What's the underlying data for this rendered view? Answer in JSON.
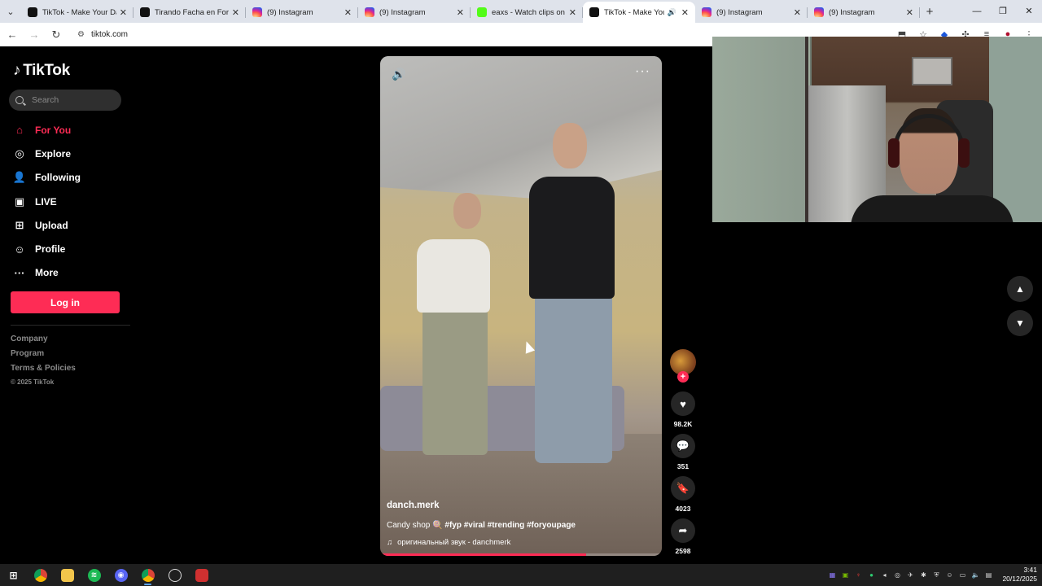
{
  "browser": {
    "tabs": [
      {
        "title": "TikTok - Make Your Day",
        "favicon": "tiktok-favicon",
        "active": false
      },
      {
        "title": "Tirando Facha en Fortnite",
        "favicon": "tiktok-favicon",
        "active": false
      },
      {
        "title": "(9) Instagram",
        "favicon": "instagram-favicon",
        "active": false
      },
      {
        "title": "(9) Instagram",
        "favicon": "instagram-favicon",
        "active": false
      },
      {
        "title": "eaxs - Watch clips on Kick",
        "favicon": "kick-favicon",
        "active": false
      },
      {
        "title": "TikTok - Make Your Day",
        "favicon": "tiktok-favicon",
        "active": true
      },
      {
        "title": "(9) Instagram",
        "favicon": "instagram-favicon",
        "active": false
      },
      {
        "title": "(9) Instagram",
        "favicon": "instagram-favicon",
        "active": false
      }
    ],
    "url": "tiktok.com"
  },
  "sidebar": {
    "logo_text": "TikTok",
    "search_placeholder": "Search",
    "nav_items": [
      {
        "label": "For You",
        "icon": "home-icon",
        "active": true
      },
      {
        "label": "Explore",
        "icon": "compass-icon",
        "active": false
      },
      {
        "label": "Following",
        "icon": "following-icon",
        "active": false
      },
      {
        "label": "LIVE",
        "icon": "live-icon",
        "active": false
      },
      {
        "label": "Upload",
        "icon": "upload-icon",
        "active": false
      },
      {
        "label": "Profile",
        "icon": "profile-icon",
        "active": false
      },
      {
        "label": "More",
        "icon": "more-icon",
        "active": false
      }
    ],
    "login_label": "Log in",
    "footer_links": [
      "Company",
      "Program",
      "Terms & Policies"
    ],
    "copyright": "© 2025 TikTok"
  },
  "video": {
    "author": "danch.merk",
    "caption_text": "Candy shop 🍭",
    "caption_tags": "#fyp #viral #trending #foryoupage",
    "sound": "оригинальный звук - danchmerk",
    "progress_fraction": 0.73
  },
  "actions": {
    "likes": "98.2K",
    "comments": "351",
    "saves": "4023",
    "shares": "2598"
  },
  "taskbar": {
    "time": "3:41",
    "date": "20/12/2025"
  },
  "colors": {
    "accent": "#fe2c55",
    "background": "#000000",
    "chip": "#262626"
  }
}
